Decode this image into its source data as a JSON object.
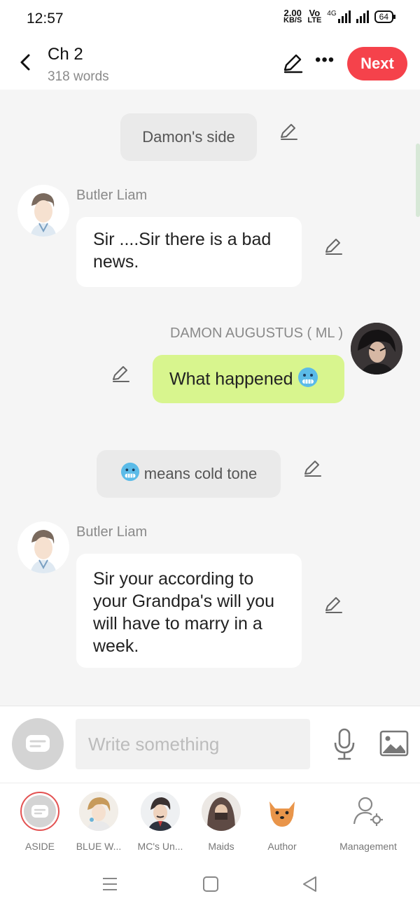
{
  "status_bar": {
    "time": "12:57",
    "speed_value": "2.00",
    "speed_unit": "KB/S",
    "volte_top": "Vo",
    "volte_bottom": "LTE",
    "network": "4G",
    "battery": "64"
  },
  "header": {
    "title": "Ch 2",
    "word_count": "318 words",
    "next_label": "Next"
  },
  "messages": [
    {
      "type": "aside",
      "text": "Damon's side"
    },
    {
      "type": "left",
      "speaker": "Butler Liam",
      "text": "Sir ....Sir  there is a bad news."
    },
    {
      "type": "right",
      "speaker": "DAMON AUGUSTUS ( ML )",
      "text": "What happened",
      "emoji": "cold-face"
    },
    {
      "type": "aside",
      "text": "means cold tone",
      "emoji": "cold-face"
    },
    {
      "type": "left",
      "speaker": "Butler Liam",
      "text": "Sir your according to your Grandpa's will you will have to marry in a week."
    }
  ],
  "input": {
    "placeholder": "Write something"
  },
  "characters": [
    {
      "label": "ASIDE",
      "icon": "aside-icon"
    },
    {
      "label": "BLUE W...",
      "icon": "character-avatar"
    },
    {
      "label": "MC's Un...",
      "icon": "character-avatar"
    },
    {
      "label": "Maids",
      "icon": "character-avatar"
    },
    {
      "label": "Author",
      "icon": "shiba-dog-avatar"
    },
    {
      "label": "Management",
      "icon": "user-gear-icon"
    }
  ],
  "colors": {
    "accent": "#f5424b",
    "right_bubble": "#d8f58e",
    "background": "#f5f5f5"
  }
}
